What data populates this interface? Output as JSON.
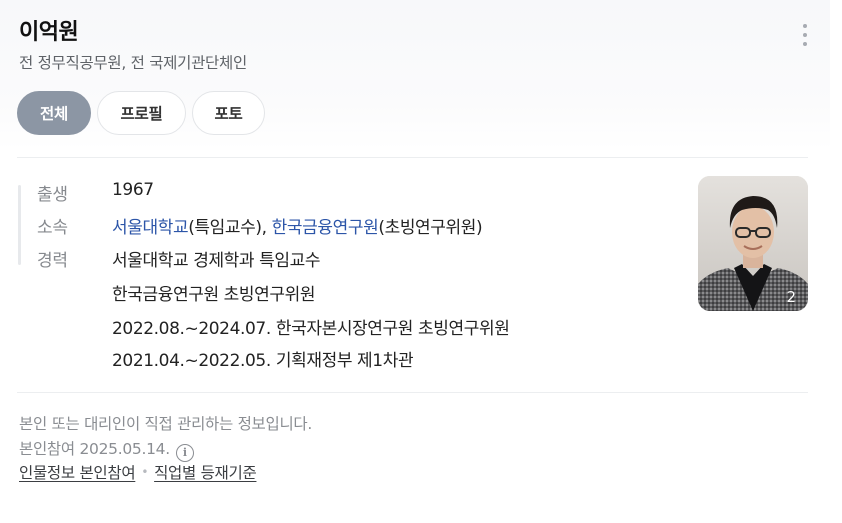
{
  "header": {
    "name": "이억원",
    "subtitle": "전 정무직공무원, 전 국제기관단체인"
  },
  "tabs": [
    {
      "label": "전체",
      "active": true
    },
    {
      "label": "프로필",
      "active": false
    },
    {
      "label": "포토",
      "active": false
    }
  ],
  "profile": {
    "birth_label": "출생",
    "birth_value": "1967",
    "affiliation_label": "소속",
    "affiliation": [
      {
        "org": "서울대학교",
        "role": "(특임교수)"
      },
      {
        "org": "한국금융연구원",
        "role": "(초빙연구위원)"
      }
    ],
    "affiliation_separator": ", ",
    "career_label": "경력",
    "career": [
      "서울대학교 경제학과 특임교수",
      "한국금융연구원 초빙연구위원",
      "2022.08.~2024.07. 한국자본시장연구원 초빙연구위원",
      "2021.04.~2022.05. 기획재정부 제1차관"
    ],
    "photo_count": "2"
  },
  "footer": {
    "note": "본인 또는 대리인이 직접 관리하는 정보입니다.",
    "participation": "본인참여 2025.05.14.",
    "info_icon": "i",
    "link1": "인물정보 본인참여",
    "link2": "직업별 등재기준"
  },
  "colors": {
    "active_tab": "#8c96a4",
    "link": "#2c55a8",
    "muted_text": "#86898e"
  }
}
